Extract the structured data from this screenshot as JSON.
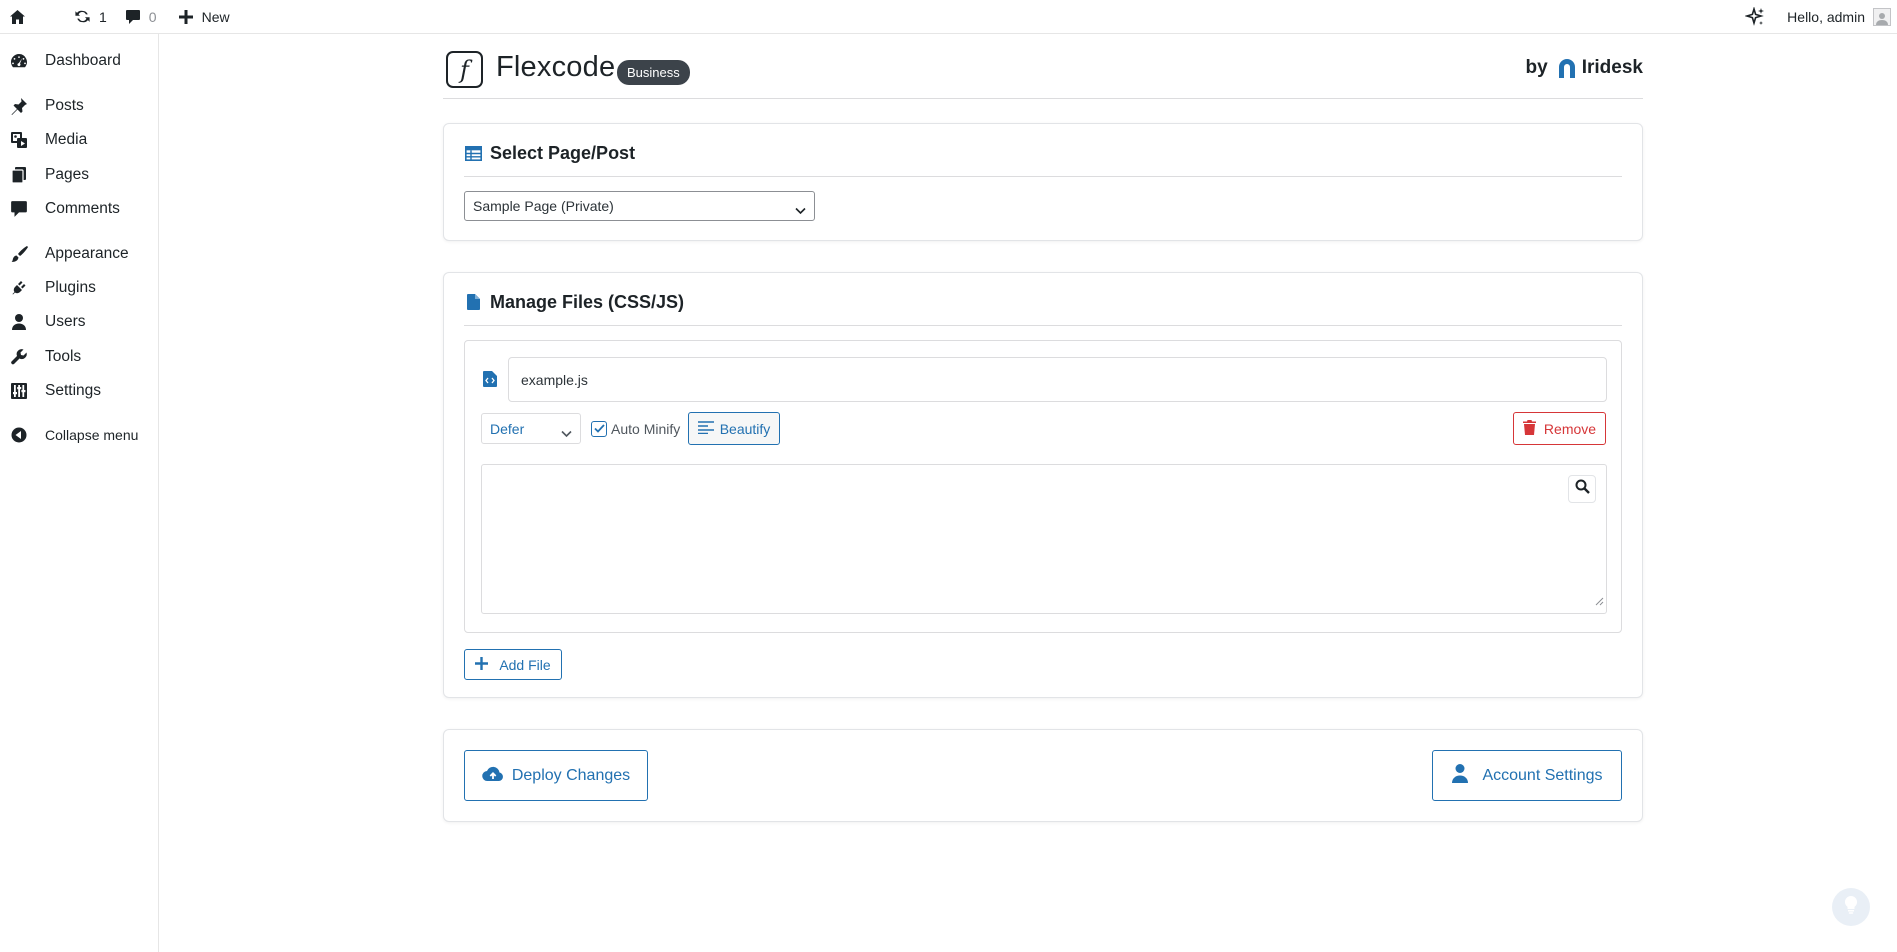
{
  "admin_bar": {
    "updates_count": "1",
    "comments_count": "0",
    "new_label": "New",
    "greeting": "Hello, admin"
  },
  "sidebar": {
    "items": [
      {
        "label": "Dashboard",
        "icon": "dashboard-icon"
      },
      {
        "label": "Posts",
        "icon": "pin-icon"
      },
      {
        "label": "Media",
        "icon": "media-icon"
      },
      {
        "label": "Pages",
        "icon": "pages-icon"
      },
      {
        "label": "Comments",
        "icon": "comment-icon"
      },
      {
        "label": "Appearance",
        "icon": "brush-icon"
      },
      {
        "label": "Plugins",
        "icon": "plug-icon"
      },
      {
        "label": "Users",
        "icon": "user-icon"
      },
      {
        "label": "Tools",
        "icon": "wrench-icon"
      },
      {
        "label": "Settings",
        "icon": "settings-icon"
      }
    ],
    "collapse_label": "Collapse menu"
  },
  "plugin": {
    "logo_glyph": "f",
    "title": "Flexcode",
    "badge": "Business",
    "by_label": "by",
    "vendor": "Iridesk"
  },
  "select_section": {
    "heading": "Select Page/Post",
    "selected": "Sample Page (Private)"
  },
  "files_section": {
    "heading": "Manage Files (CSS/JS)",
    "file": {
      "name": "example.js",
      "load_mode": "Defer",
      "auto_minify_label": "Auto Minify",
      "auto_minify_checked": true,
      "beautify_label": "Beautify",
      "remove_label": "Remove"
    },
    "add_file_label": "Add File"
  },
  "actions": {
    "deploy_label": "Deploy Changes",
    "account_label": "Account Settings"
  },
  "colors": {
    "accent": "#2271b1",
    "danger": "#d63638",
    "badge_bg": "#3c434a"
  }
}
